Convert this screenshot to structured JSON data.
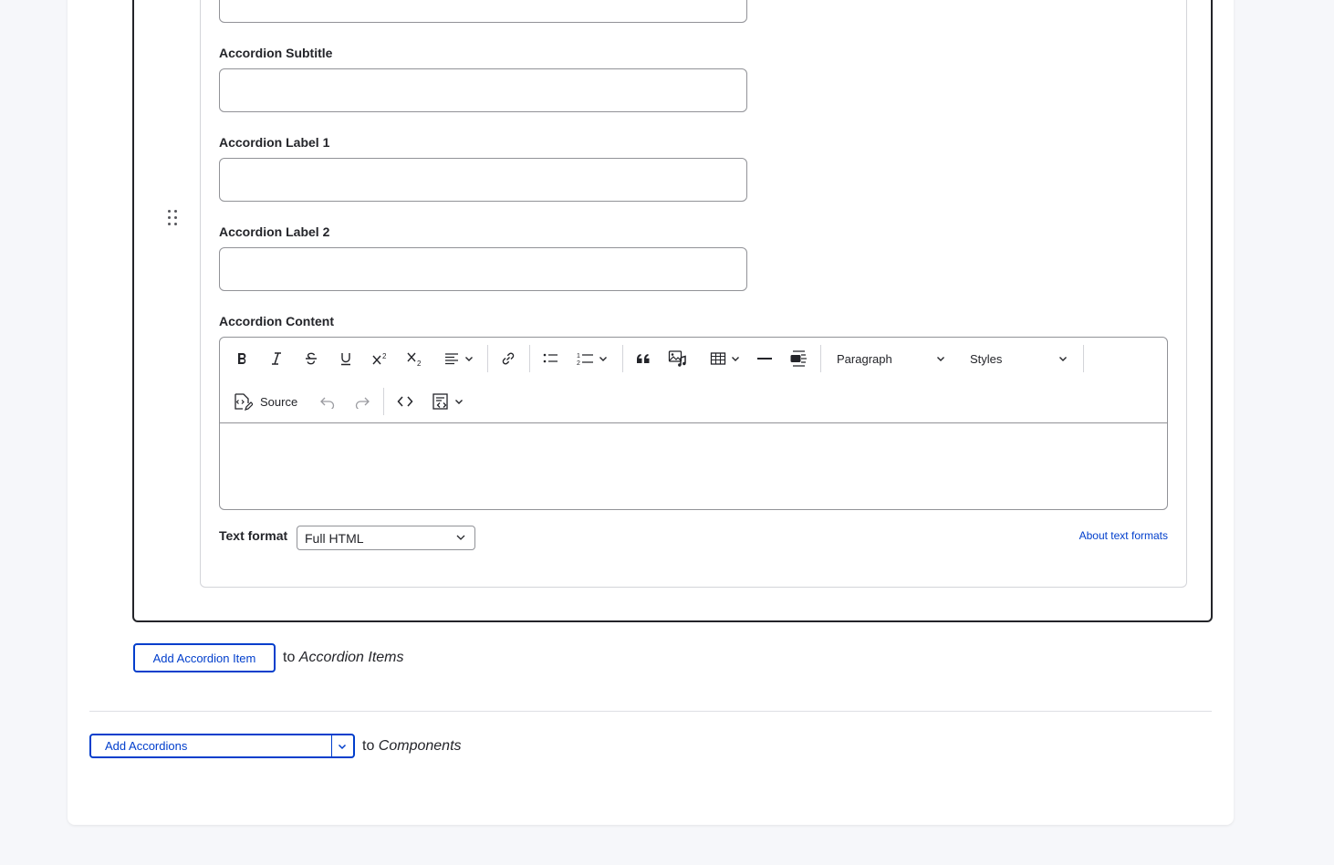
{
  "fields": {
    "subtitle_label": "Accordion Subtitle",
    "label1_label": "Accordion Label 1",
    "label2_label": "Accordion Label 2",
    "content_label": "Accordion Content"
  },
  "editor": {
    "paragraph_label": "Paragraph",
    "styles_label": "Styles",
    "source_label": "Source"
  },
  "text_format": {
    "label": "Text format",
    "selected": "Full HTML",
    "about_link": "About text formats"
  },
  "actions": {
    "add_item_label": "Add Accordion Item",
    "add_item_to": "to",
    "add_item_target": "Accordion Items",
    "add_component_label": "Add Accordions",
    "add_component_to": "to",
    "add_component_target": "Components"
  },
  "colors": {
    "accent": "#003ecc",
    "text": "#232429",
    "border": "#919297"
  }
}
